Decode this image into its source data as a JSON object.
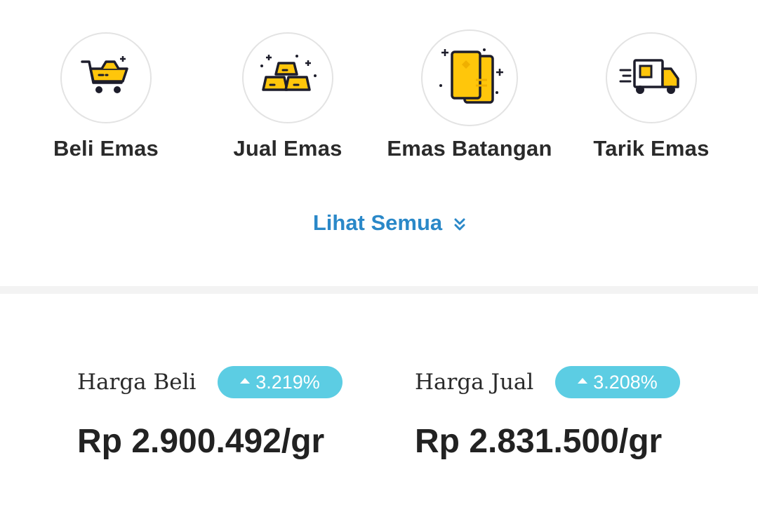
{
  "menu": {
    "items": [
      {
        "label": "Beli Emas",
        "icon": "cart-icon"
      },
      {
        "label": "Jual Emas",
        "icon": "gold-bars-icon"
      },
      {
        "label": "Emas Batangan",
        "icon": "gold-cards-icon"
      },
      {
        "label": "Tarik Emas",
        "icon": "delivery-truck-icon"
      }
    ],
    "see_all_label": "Lihat Semua",
    "see_all_icon": "double-chevron-down-icon"
  },
  "prices": {
    "buy": {
      "title": "Harga Beli",
      "change": "3.219%",
      "value": "Rp 2.900.492/gr"
    },
    "sell": {
      "title": "Harga Jual",
      "change": "3.208%",
      "value": "Rp 2.831.500/gr"
    }
  },
  "colors": {
    "accent_gold": "#ffc60b",
    "link_blue": "#2a88c8",
    "badge_cyan": "#5ccde3",
    "icon_outline": "#1d1d2b"
  }
}
